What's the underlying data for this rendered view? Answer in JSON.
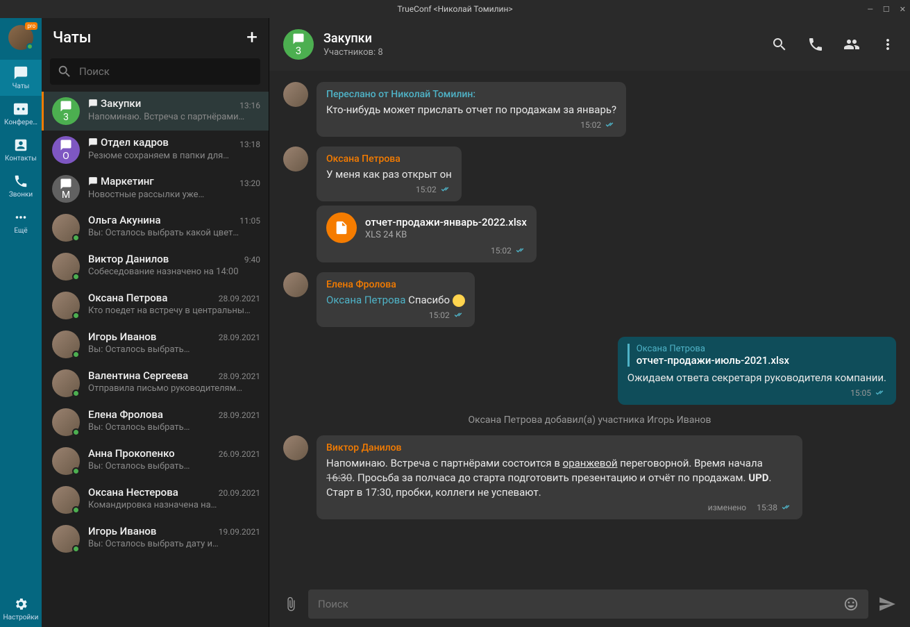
{
  "titlebar": {
    "title": "TrueConf <Николай Томилин>"
  },
  "navrail": {
    "avatar_badge": "pro",
    "items": [
      {
        "id": "chats",
        "label": "Чаты"
      },
      {
        "id": "confs",
        "label": "Конфере…"
      },
      {
        "id": "contacts",
        "label": "Контакты"
      },
      {
        "id": "calls",
        "label": "Звонки"
      },
      {
        "id": "more",
        "label": "Ещё"
      }
    ],
    "settings_label": "Настройки"
  },
  "chats_panel": {
    "title": "Чаты",
    "search_placeholder": "Поиск",
    "items": [
      {
        "name": "Закупки",
        "time": "13:16",
        "preview": "Напоминаю. Встреча с партнёрами…",
        "group": true,
        "letter": "3",
        "color": "avatar-green",
        "active": true
      },
      {
        "name": "Отдел кадров",
        "time": "13:18",
        "preview": "Резюме сохраняем в папки для…",
        "group": true,
        "letter": "О",
        "color": "avatar-purple"
      },
      {
        "name": "Маркетинг",
        "time": "13:20",
        "preview": "Новостные рассылки уже…",
        "group": true,
        "letter": "М",
        "color": "avatar-gray"
      },
      {
        "name": "Ольга Акунина",
        "time": "11:05",
        "preview": "Вы: Осталось выбрать какой цвет…",
        "person": true
      },
      {
        "name": "Виктор Данилов",
        "time": "9:40",
        "preview": "Собеседование назначено на 14:00",
        "person": true
      },
      {
        "name": "Оксана Петрова",
        "time": "28.09.2021",
        "preview": "Кто поедет на встречу в центральны…",
        "person": true
      },
      {
        "name": "Игорь Иванов",
        "time": "28.09.2021",
        "preview": "Вы: Осталось выбрать…",
        "person": true
      },
      {
        "name": "Валентина Сергеева",
        "time": "28.09.2021",
        "preview": "Отправила письмо руководителям…",
        "person": true
      },
      {
        "name": "Елена Фролова",
        "time": "28.09.2021",
        "preview": "Вы: Осталось выбрать…",
        "person": true
      },
      {
        "name": "Анна Прокопенко",
        "time": "26.09.2021",
        "preview": "Вы: Осталось выбрать…",
        "person": true
      },
      {
        "name": "Оксана Нестерова",
        "time": "20.09.2021",
        "preview": "Командировка назначена на…",
        "person": true
      },
      {
        "name": "Игорь Иванов",
        "time": "19.09.2021",
        "preview": "Вы: Осталось выбрать дату и…",
        "person": true
      }
    ]
  },
  "chat_header": {
    "title": "Закупки",
    "subtitle": "Участников: 8",
    "avatar_letter": "3"
  },
  "messages": {
    "m1_fwd": "Переслано от Николай Томилин:",
    "m1_text": "Кто-нибудь может прислать отчет по продажам за январь?",
    "m1_time": "15:02",
    "m2_sender": "Оксана Петрова",
    "m2_text": "У меня как раз открыт он",
    "m2_time": "15:02",
    "m3_file": "отчет-продажи-январь-2022.xlsx",
    "m3_size": "XLS 24 KB",
    "m3_time": "15:02",
    "m4_sender": "Елена Фролова",
    "m4_mention": "Оксана Петрова",
    "m4_text": " Спасибо ",
    "m4_time": "15:02",
    "m5_quote_name": "Оксана Петрова",
    "m5_quote_file": "отчет-продажи-июль-2021.xlsx",
    "m5_text": "Ожидаем ответа секретаря руководителя компании.",
    "m5_time": "15:05",
    "sys": "Оксана Петрова добавил(а) участника Игорь Иванов",
    "m6_sender": "Виктор Данилов",
    "m6_text_a": "Напоминаю. Встреча с партнёрами состоится в ",
    "m6_under": "оранжевой",
    "m6_text_b": " переговорной. Время начала ",
    "m6_strike": "16:30",
    "m6_text_c": ". Просьба за полчаса до старта подготовить презентацию и отчёт по продажам. ",
    "m6_bold": "UPD",
    "m6_text_d": ". Старт в 17:30, пробки, коллеги не успевают.",
    "m6_edited": "изменено",
    "m6_time": "15:38"
  },
  "composer": {
    "placeholder": "Поиск"
  }
}
